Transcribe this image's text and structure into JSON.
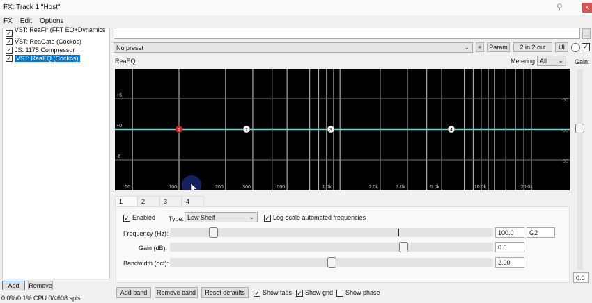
{
  "window": {
    "title": "FX: Track 1 \"Host\"",
    "close": "x"
  },
  "menu": [
    "FX",
    "Edit",
    "Options"
  ],
  "fx_list": [
    {
      "label": "VST: ReaFir (FFT EQ+Dynamics ...",
      "checked": true,
      "selected": false
    },
    {
      "label": "VST: ReaGate (Cockos)",
      "checked": true,
      "selected": false
    },
    {
      "label": "JS: 1175 Compressor",
      "checked": true,
      "selected": false
    },
    {
      "label": "VST: ReaEQ (Cockos)",
      "checked": true,
      "selected": true
    }
  ],
  "fx_buttons": {
    "add": "Add",
    "remove": "Remove"
  },
  "status": "0.0%/0.1% CPU 0/4608 spls",
  "top": {
    "name_value": "",
    "more": "...",
    "preset": "No preset",
    "plus": "+",
    "param": "Param",
    "io": "2 in 2 out",
    "ui": "UI"
  },
  "plugin": {
    "name": "ReaEQ",
    "metering_label": "Metering:",
    "metering_value": "All",
    "gain_label": "Gain:",
    "gain_value": "0.0"
  },
  "graph": {
    "left_labels": [
      "+6",
      "+0",
      "-6"
    ],
    "right_labels": [
      "-30",
      "-60",
      "-90"
    ],
    "freq_labels": [
      "50",
      "100",
      "200",
      "300",
      "500",
      "1.0k",
      "2.0k",
      "3.0k",
      "5.0k",
      "10.0k",
      "20.0k"
    ],
    "bands": [
      {
        "label": "1",
        "active": true
      },
      {
        "label": "2"
      },
      {
        "label": "3"
      },
      {
        "label": "4"
      }
    ],
    "curve_color": "#7fd0d0",
    "active_color": "#e02020"
  },
  "tabs": [
    "1",
    "2",
    "3",
    "4"
  ],
  "band": {
    "enabled_label": "Enabled",
    "type_label": "Type:",
    "type_value": "Low Shelf",
    "logscale_label": "Log-scale automated frequencies",
    "frequency_label": "Frequency (Hz):",
    "frequency_value": "100.0",
    "note": "G2",
    "frequency_pos": 0.12,
    "gain_label": "Gain (dB):",
    "gain_value": "0.0",
    "gain_pos": 0.71,
    "bandwidth_label": "Bandwidth (oct):",
    "bandwidth_value": "2.00",
    "bandwidth_pos": 0.5
  },
  "bottom": {
    "add_band": "Add band",
    "remove_band": "Remove band",
    "reset": "Reset defaults",
    "show_tabs": "Show tabs",
    "show_tabs_checked": true,
    "show_grid": "Show grid",
    "show_grid_checked": true,
    "show_phase": "Show phase",
    "show_phase_checked": false
  }
}
